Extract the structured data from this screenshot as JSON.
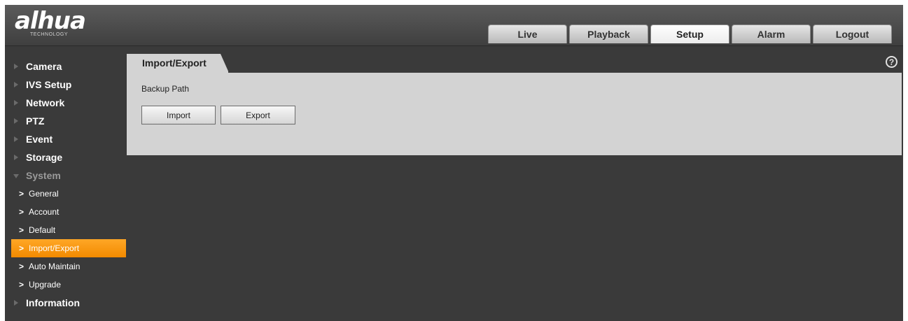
{
  "brand": {
    "logo_text": "alhua",
    "logo_subtext": "TECHNOLOGY"
  },
  "top_tabs": [
    {
      "label": "Live"
    },
    {
      "label": "Playback"
    },
    {
      "label": "Setup",
      "active": true
    },
    {
      "label": "Alarm"
    },
    {
      "label": "Logout"
    }
  ],
  "sidebar": {
    "items": [
      {
        "label": "Camera"
      },
      {
        "label": "IVS Setup"
      },
      {
        "label": "Network"
      },
      {
        "label": "PTZ"
      },
      {
        "label": "Event"
      },
      {
        "label": "Storage"
      },
      {
        "label": "System",
        "expanded": true
      }
    ],
    "system_subitems": [
      {
        "label": "General"
      },
      {
        "label": "Account"
      },
      {
        "label": "Default"
      },
      {
        "label": "Import/Export",
        "active": true
      },
      {
        "label": "Auto Maintain"
      },
      {
        "label": "Upgrade"
      }
    ],
    "last_item": {
      "label": "Information"
    },
    "chevron": ">"
  },
  "content": {
    "tab_label": "Import/Export",
    "backup_path_label": "Backup Path",
    "import_label": "Import",
    "export_label": "Export"
  },
  "help_icon_text": "?",
  "colors": {
    "accent": "#f28a00",
    "background": "#3a3a3a",
    "panel": "#d3d3d3"
  }
}
